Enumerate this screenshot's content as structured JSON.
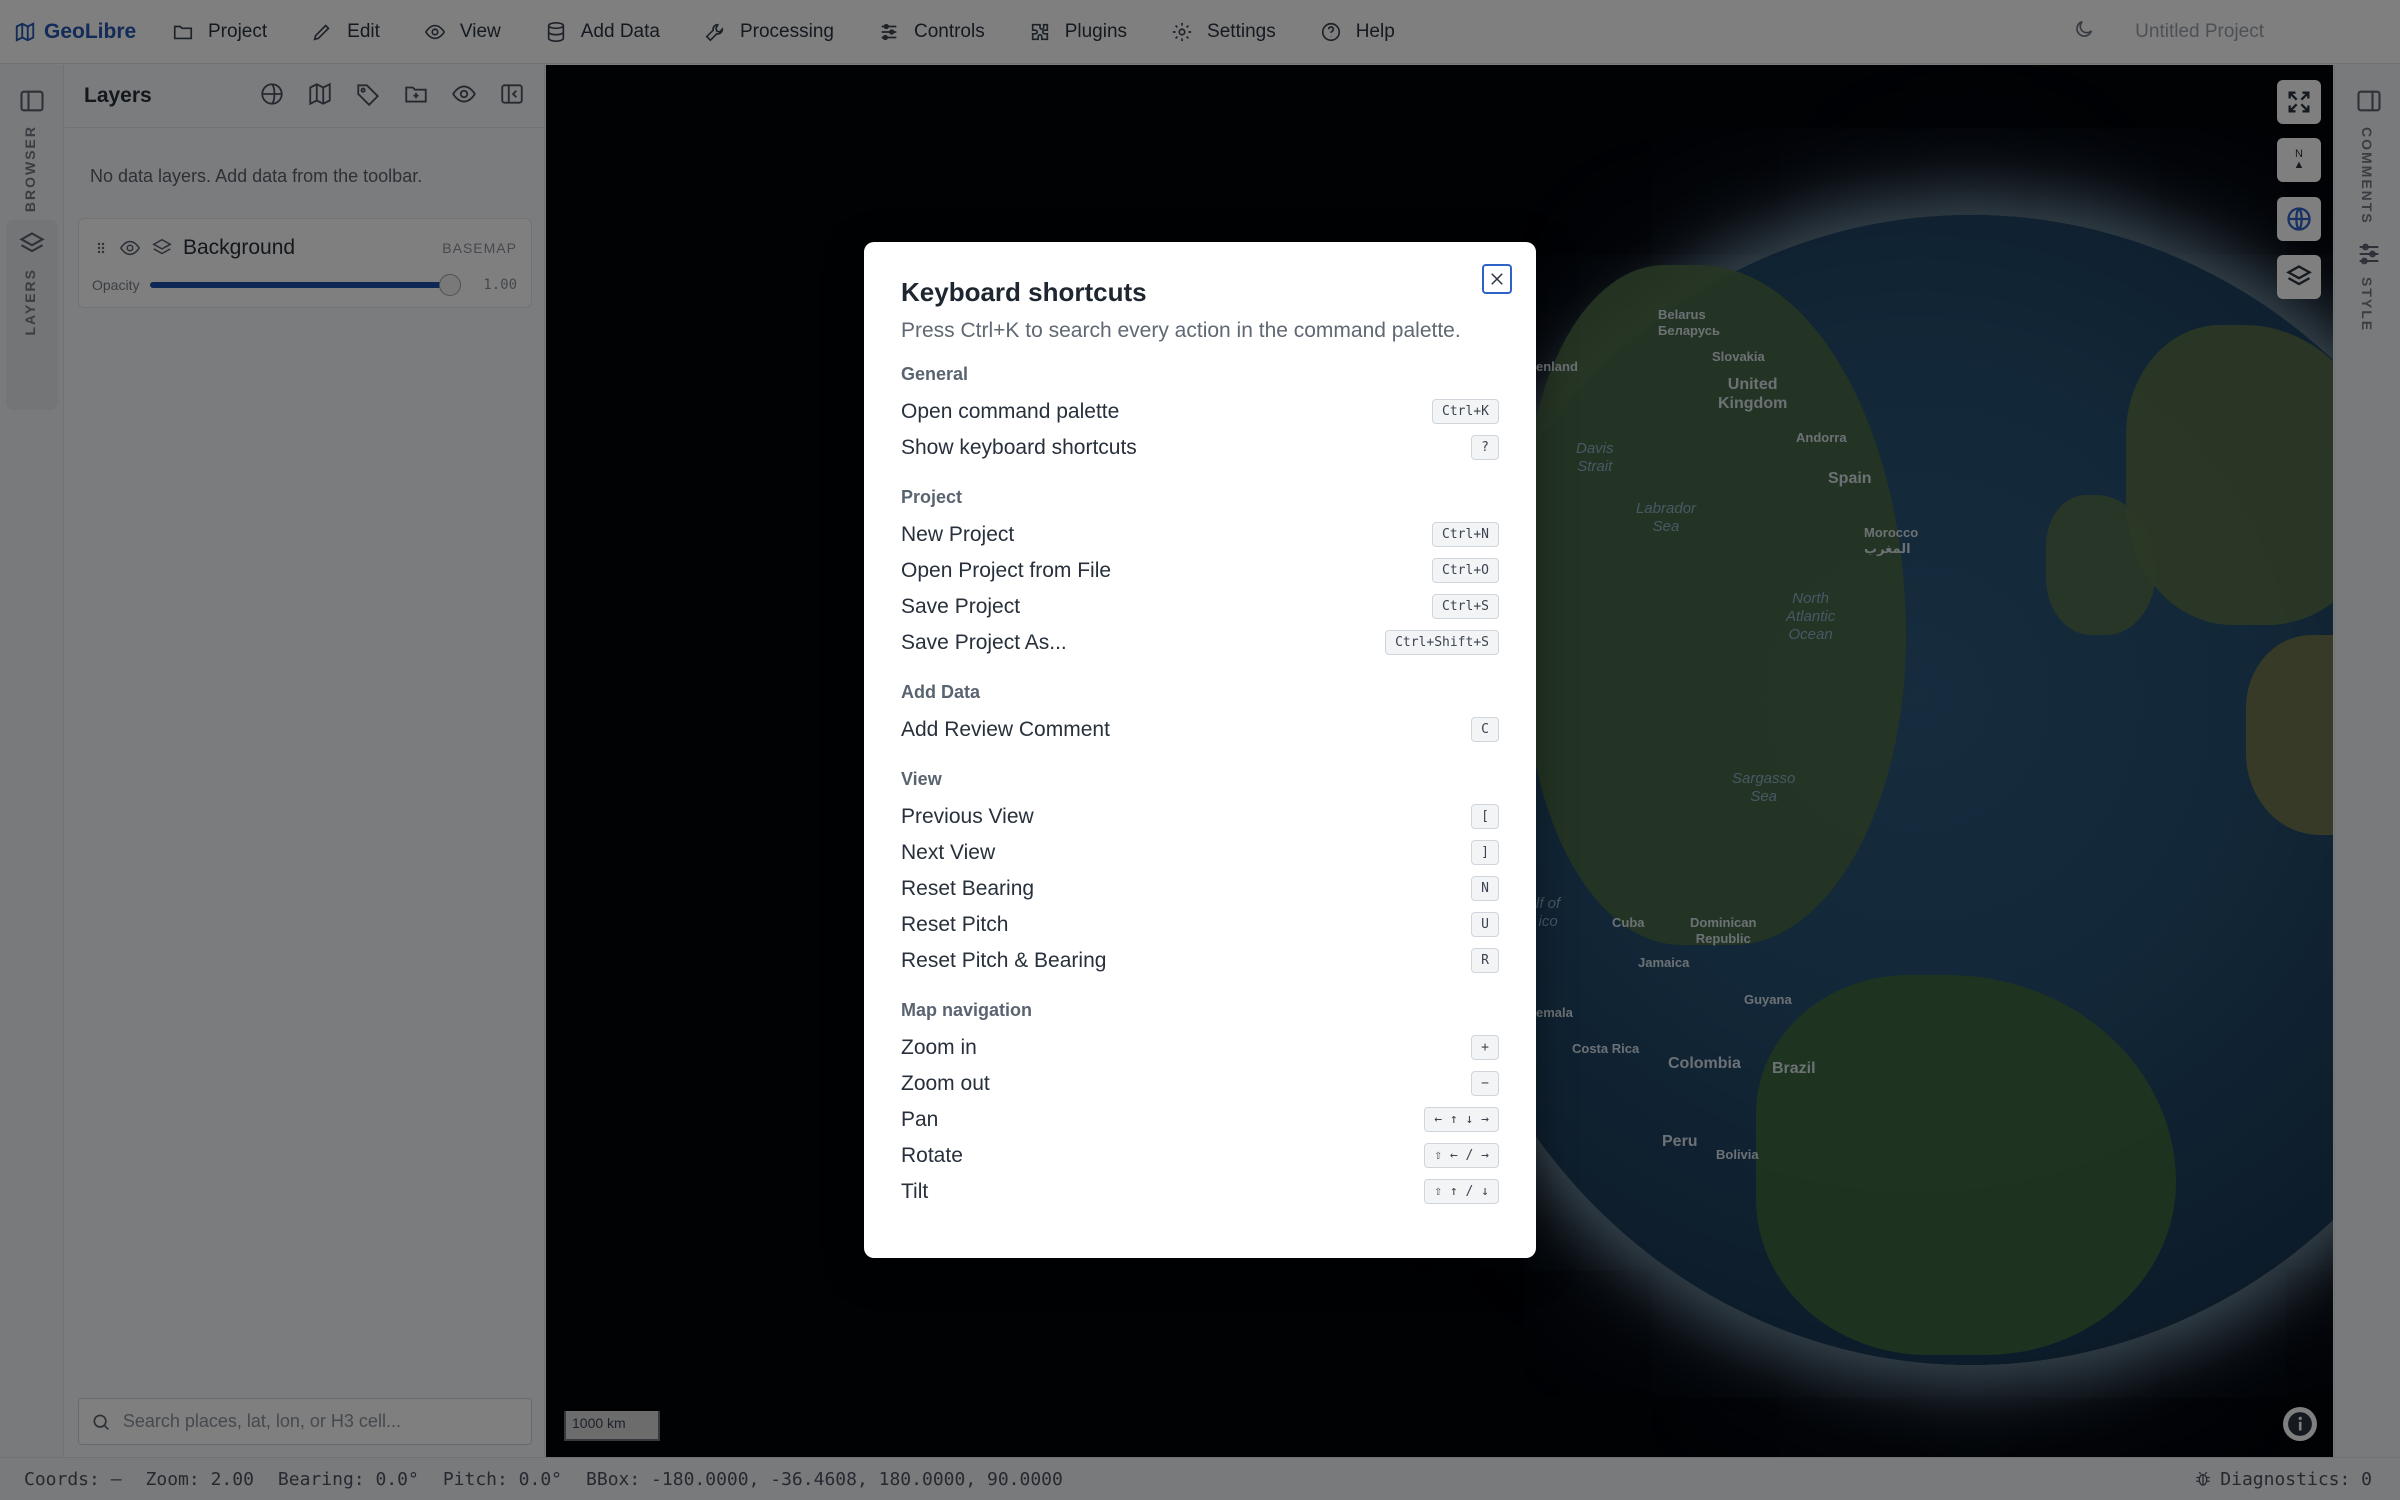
{
  "app": {
    "name": "GeoLibre",
    "project_name": "Untitled Project"
  },
  "menu": [
    {
      "label": "Project",
      "icon": "folder-icon"
    },
    {
      "label": "Edit",
      "icon": "pencil-icon"
    },
    {
      "label": "View",
      "icon": "eye-icon"
    },
    {
      "label": "Add Data",
      "icon": "database-icon"
    },
    {
      "label": "Processing",
      "icon": "wrench-icon"
    },
    {
      "label": "Controls",
      "icon": "sliders-icon"
    },
    {
      "label": "Plugins",
      "icon": "puzzle-icon"
    },
    {
      "label": "Settings",
      "icon": "gear-icon"
    },
    {
      "label": "Help",
      "icon": "help-circle-icon"
    }
  ],
  "left_rail": {
    "browser_label": "BROWSER",
    "layers_label": "LAYERS"
  },
  "right_rail": {
    "comments_label": "COMMENTS",
    "style_label": "STYLE"
  },
  "layers_panel": {
    "title": "Layers",
    "empty_message": "No data layers. Add data from the toolbar.",
    "layer": {
      "name": "Background",
      "badge": "BASEMAP",
      "opacity_label": "Opacity",
      "opacity_value": "1.00",
      "opacity": 1.0
    },
    "search_placeholder": "Search places, lat, lon, or H3 cell..."
  },
  "map": {
    "scale_label": "1000 km",
    "compass_label": "N",
    "labels": {
      "belarus": "Belarus\nБеларусь",
      "slovakia": "Slovakia",
      "finland": "enland",
      "uk": "United\nKingdom",
      "andorra": "Andorra",
      "spain": "Spain",
      "morocco": "Morocco\nالمغرب",
      "davis": "Davis\nStrait",
      "labrador": "Labrador\nSea",
      "atlantic": "North\nAtlantic\nOcean",
      "sargasso": "Sargasso\nSea",
      "gulf": "lf of\nico",
      "cuba": "Cuba",
      "dominican": "Dominican\nRepublic",
      "jamaica": "Jamaica",
      "guatemala": "emala",
      "costa_rica": "Costa Rica",
      "guyana": "Guyana",
      "colombia": "Colombia",
      "brazil": "Brazil",
      "peru": "Peru",
      "bolivia": "Bolivia"
    }
  },
  "status": {
    "coords": "Coords: —",
    "zoom": "Zoom: 2.00",
    "bearing": "Bearing: 0.0°",
    "pitch": "Pitch: 0.0°",
    "bbox": "BBox: -180.0000, -36.4608, 180.0000, 90.0000",
    "diagnostics": "Diagnostics: 0"
  },
  "dialog": {
    "title": "Keyboard shortcuts",
    "subtitle": "Press Ctrl+K to search every action in the command palette.",
    "sections": [
      {
        "title": "General",
        "items": [
          {
            "label": "Open command palette",
            "key": "Ctrl+K"
          },
          {
            "label": "Show keyboard shortcuts",
            "key": "?"
          }
        ]
      },
      {
        "title": "Project",
        "items": [
          {
            "label": "New Project",
            "key": "Ctrl+N"
          },
          {
            "label": "Open Project from File",
            "key": "Ctrl+O"
          },
          {
            "label": "Save Project",
            "key": "Ctrl+S"
          },
          {
            "label": "Save Project As...",
            "key": "Ctrl+Shift+S"
          }
        ]
      },
      {
        "title": "Add Data",
        "items": [
          {
            "label": "Add Review Comment",
            "key": "C"
          }
        ]
      },
      {
        "title": "View",
        "items": [
          {
            "label": "Previous View",
            "key": "["
          },
          {
            "label": "Next View",
            "key": "]"
          },
          {
            "label": "Reset Bearing",
            "key": "N"
          },
          {
            "label": "Reset Pitch",
            "key": "U"
          },
          {
            "label": "Reset Pitch & Bearing",
            "key": "R"
          }
        ]
      },
      {
        "title": "Map navigation",
        "items": [
          {
            "label": "Zoom in",
            "key": "+"
          },
          {
            "label": "Zoom out",
            "key": "−"
          },
          {
            "label": "Pan",
            "key": "← ↑ ↓ →"
          },
          {
            "label": "Rotate",
            "key": "⇧ ← / →"
          },
          {
            "label": "Tilt",
            "key": "⇧ ↑ / ↓"
          }
        ]
      }
    ]
  },
  "colors": {
    "brand": "#2456b3",
    "slider": "#1f4fa8",
    "overlay": "rgba(0,0,0,0.5)"
  }
}
